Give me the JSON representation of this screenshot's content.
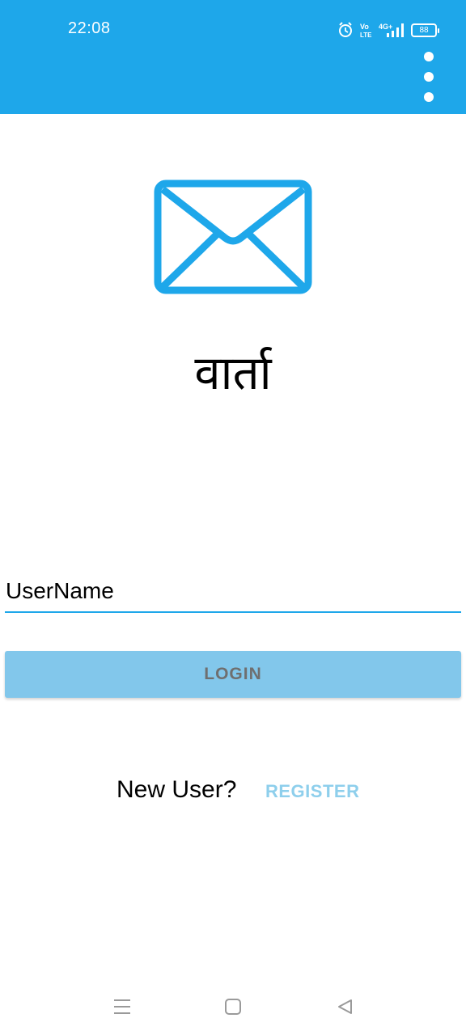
{
  "status_bar": {
    "time": "22:08",
    "battery": "88",
    "network": "4G+",
    "volte": "Vo LTE",
    "icons": [
      "alarm-icon",
      "volte-icon",
      "signal-icon",
      "battery-icon"
    ]
  },
  "app_bar": {
    "menu_icon": "more-vertical-icon"
  },
  "logo": {
    "icon": "envelope-icon"
  },
  "app_name": "वार्ता",
  "login_form": {
    "username_placeholder": "UserName",
    "login_label": "LOGIN"
  },
  "register_prompt": {
    "question": "New User?",
    "register_label": "REGISTER"
  },
  "nav_bar": {
    "icons": [
      "menu-lines-icon",
      "home-square-icon",
      "back-triangle-icon"
    ]
  },
  "colors": {
    "primary": "#1ea7ea",
    "button": "#82c7eb",
    "register_link": "#8ecfec"
  }
}
